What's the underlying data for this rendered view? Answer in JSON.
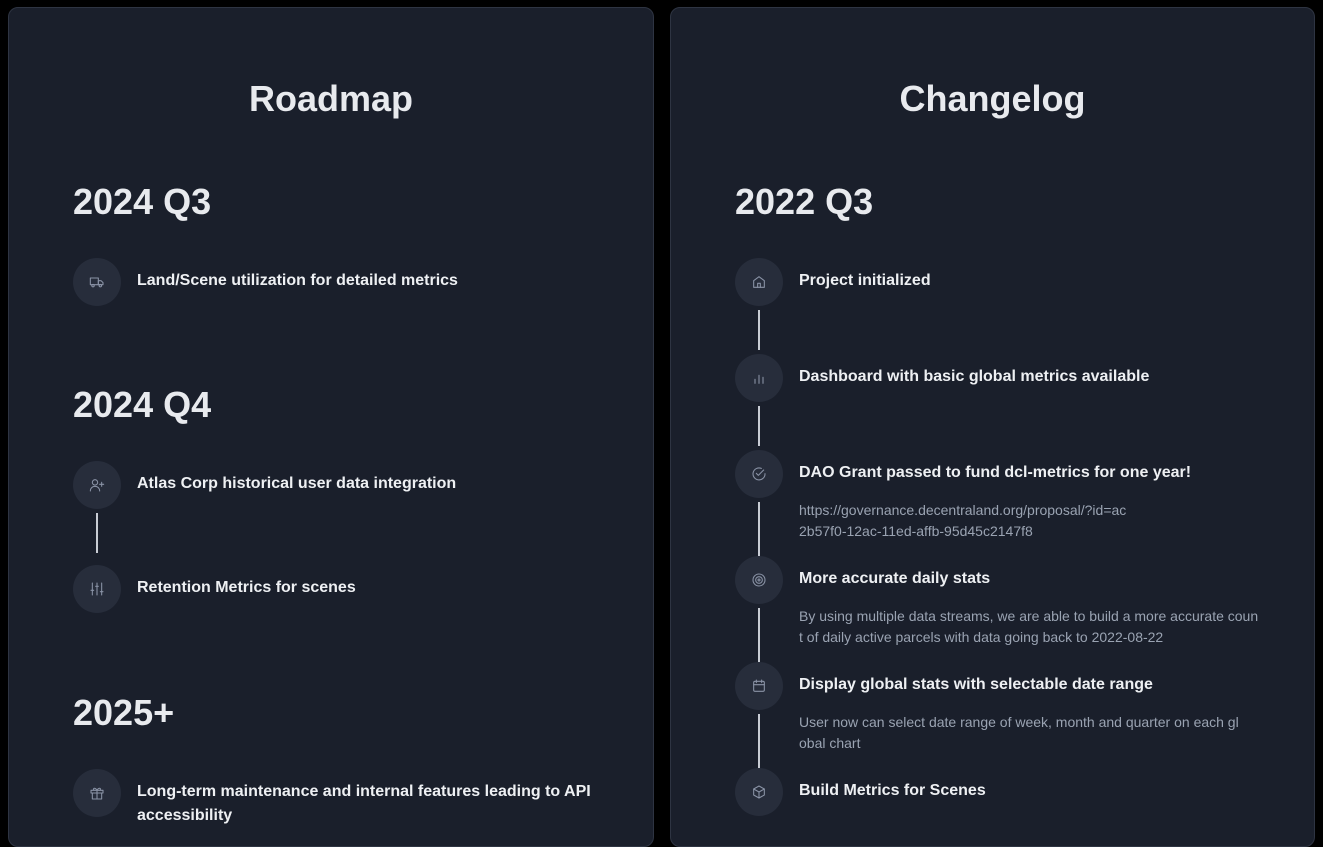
{
  "roadmap": {
    "title": "Roadmap",
    "sections": [
      {
        "heading": "2024 Q3",
        "items": [
          {
            "icon": "truck-icon",
            "title": "Land/Scene utilization for detailed metrics"
          }
        ]
      },
      {
        "heading": "2024 Q4",
        "items": [
          {
            "icon": "user-plus-icon",
            "title": "Atlas Corp historical user data integration"
          },
          {
            "icon": "sliders-icon",
            "title": "Retention Metrics for scenes"
          }
        ]
      },
      {
        "heading": "2025+",
        "items": [
          {
            "icon": "gift-icon",
            "title": "Long-term maintenance and internal features leading to API accessibility"
          }
        ]
      }
    ]
  },
  "changelog": {
    "title": "Changelog",
    "sections": [
      {
        "heading": "2022 Q3",
        "items": [
          {
            "icon": "home-icon",
            "title": "Project initialized",
            "description": ""
          },
          {
            "icon": "bar-chart-icon",
            "title": "Dashboard with basic global metrics available",
            "description": ""
          },
          {
            "icon": "check-circle-icon",
            "title": "DAO Grant passed to fund dcl-metrics for one year!",
            "description": "https://governance.decentraland.org/proposal/?id=ac2b57f0-12ac-11ed-affb-95d45c2147f8"
          },
          {
            "icon": "target-icon",
            "title": "More accurate daily stats",
            "description": "By using multiple data streams, we are able to build a more accurate count of daily active parcels with data going back to 2022-08-22"
          },
          {
            "icon": "calendar-icon",
            "title": "Display global stats with selectable date range",
            "description": "User now can select date range of week, month and quarter on each global chart"
          },
          {
            "icon": "box-icon",
            "title": "Build Metrics for Scenes",
            "description": ""
          }
        ]
      }
    ]
  }
}
